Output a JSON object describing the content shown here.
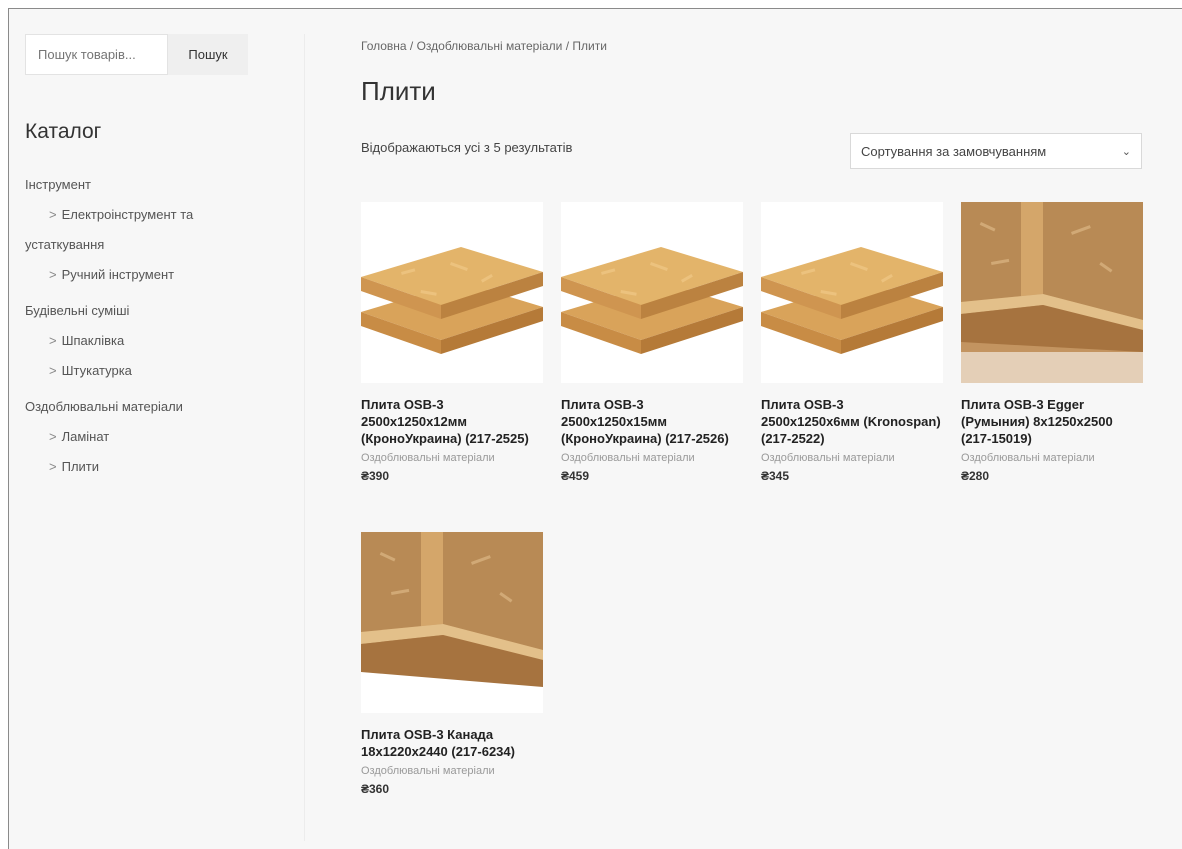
{
  "search": {
    "placeholder": "Пошук товарів...",
    "button_label": "Пошук"
  },
  "sidebar": {
    "title": "Каталог",
    "categories": [
      {
        "label": "Інструмент"
      },
      {
        "label": "Електроінструмент та устаткування"
      },
      {
        "label": "Ручний інструмент"
      },
      {
        "label": "Будівельні суміші"
      },
      {
        "label": "Шпаклівка"
      },
      {
        "label": "Штукатурка"
      },
      {
        "label": "Оздоблювальні матеріали"
      },
      {
        "label": "Ламінат"
      },
      {
        "label": "Плити"
      }
    ],
    "wrap_first": "Електроінструмент та",
    "wrap_second": "устаткування"
  },
  "breadcrumb": "Головна / Оздоблювальні матеріали / Плити",
  "page_title": "Плити",
  "result_count": "Відображаються усі з 5 результатів",
  "sort": {
    "selected": "Сортування за замовчуванням",
    "icon": "chevron-down-icon"
  },
  "products": [
    {
      "name_bold": "Плита",
      "name_rest": " OSB-3 2500x1250x12мм (КроноУкраина) (217-2525)",
      "category": "Оздоблювальні матеріали",
      "price": "₴390"
    },
    {
      "name_bold": "Плита",
      "name_rest": " OSB-3 2500x1250x15мм (КроноУкраина) (217-2526)",
      "category": "Оздоблювальні матеріали",
      "price": "₴459"
    },
    {
      "name_bold": "Плита",
      "name_rest": " OSB-3 2500x1250x6мм (Kronospan) (217-2522)",
      "category": "Оздоблювальні матеріали",
      "price": "₴345"
    },
    {
      "name_bold": "Плита",
      "name_rest": " OSB-3 Egger (Румыния) 8x1250x2500 (217-15019)",
      "category": "Оздоблювальні матеріали",
      "price": "₴280"
    },
    {
      "name_bold": "Плита",
      "name_rest": " OSB-3 Канада 18x1220x2440 (217-6234)",
      "category": "Оздоблювальні матеріали",
      "price": "₴360"
    }
  ],
  "colors": {
    "page_bg": "#f7f7f7",
    "osb_light": "#e0b068",
    "osb_dark": "#b8803f"
  }
}
